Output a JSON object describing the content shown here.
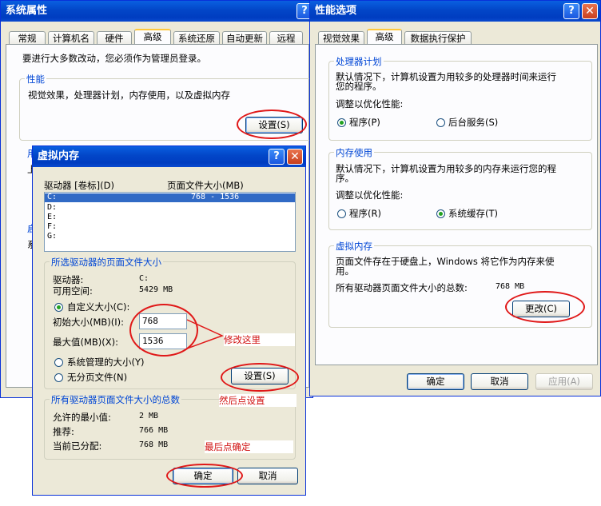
{
  "system_props": {
    "title": "系统属性",
    "help": "?",
    "tabs": [
      "常规",
      "计算机名",
      "硬件",
      "高级",
      "系统还原",
      "自动更新",
      "远程"
    ],
    "admin_note": "要进行大多数改动，您必须作为管理员登录。",
    "perf_group": "性能",
    "perf_desc": "视觉效果，处理器计划，内存使用，以及虚拟内存",
    "settings_btn": "设置(S)",
    "partial1": "用",
    "partial2": "上",
    "partial3": "启",
    "partial4": "系"
  },
  "perf_options": {
    "title": "性能选项",
    "help": "?",
    "close": "✕",
    "tabs": [
      "视觉效果",
      "高级",
      "数据执行保护"
    ],
    "cpu_group": "处理器计划",
    "cpu_desc1": "默认情况下，计算机设置为用较多的处理器时间来运行",
    "cpu_desc2": "您的程序。",
    "cpu_adjust": "调整以优化性能:",
    "cpu_opt1": "程序(P)",
    "cpu_opt2": "后台服务(S)",
    "mem_group": "内存使用",
    "mem_desc1": "默认情况下，计算机设置为用较多的内存来运行您的程",
    "mem_desc2": "序。",
    "mem_adjust": "调整以优化性能:",
    "mem_opt1": "程序(R)",
    "mem_opt2": "系统缓存(T)",
    "vm_group": "虚拟内存",
    "vm_desc1": "页面文件存在于硬盘上，Windows 将它作为内存来使",
    "vm_desc2": "用。",
    "vm_total_label": "所有驱动器页面文件大小的总数:",
    "vm_total_value": "768 MB",
    "change_btn": "更改(C)",
    "ok": "确定",
    "cancel": "取消",
    "apply": "应用(A)"
  },
  "virtual_memory": {
    "title": "虚拟内存",
    "help": "?",
    "close": "✕",
    "col_drive": "驱动器 [卷标](D)",
    "col_size": "页面文件大小(MB)",
    "drives": [
      {
        "drive": "C:",
        "size": "768 - 1536"
      },
      {
        "drive": "D:",
        "size": ""
      },
      {
        "drive": "E:",
        "size": ""
      },
      {
        "drive": "F:",
        "size": ""
      },
      {
        "drive": "G:",
        "size": ""
      }
    ],
    "selected_group": "所选驱动器的页面文件大小",
    "drive_label": "驱动器:",
    "drive_value": "C:",
    "space_label": "可用空间:",
    "space_value": "5429 MB",
    "custom_size": "自定义大小(C):",
    "initial_label": "初始大小(MB)(I):",
    "initial_value": "768",
    "max_label": "最大值(MB)(X):",
    "max_value": "1536",
    "system_managed": "系统管理的大小(Y)",
    "no_paging": "无分页文件(N)",
    "set_btn": "设置(S)",
    "total_group": "所有驱动器页面文件大小的总数",
    "min_label": "允许的最小值:",
    "min_value": "2 MB",
    "rec_label": "推荐:",
    "rec_value": "766 MB",
    "cur_label": "当前已分配:",
    "cur_value": "768 MB",
    "ok": "确定",
    "cancel": "取消"
  },
  "annotations": {
    "modify_here": "修改这里",
    "then_set": "然后点设置",
    "finally_ok": "最后点确定"
  },
  "colors": {
    "annotation": "#e01818",
    "title_bar": "#0246c8",
    "group_title": "#0046d5"
  }
}
